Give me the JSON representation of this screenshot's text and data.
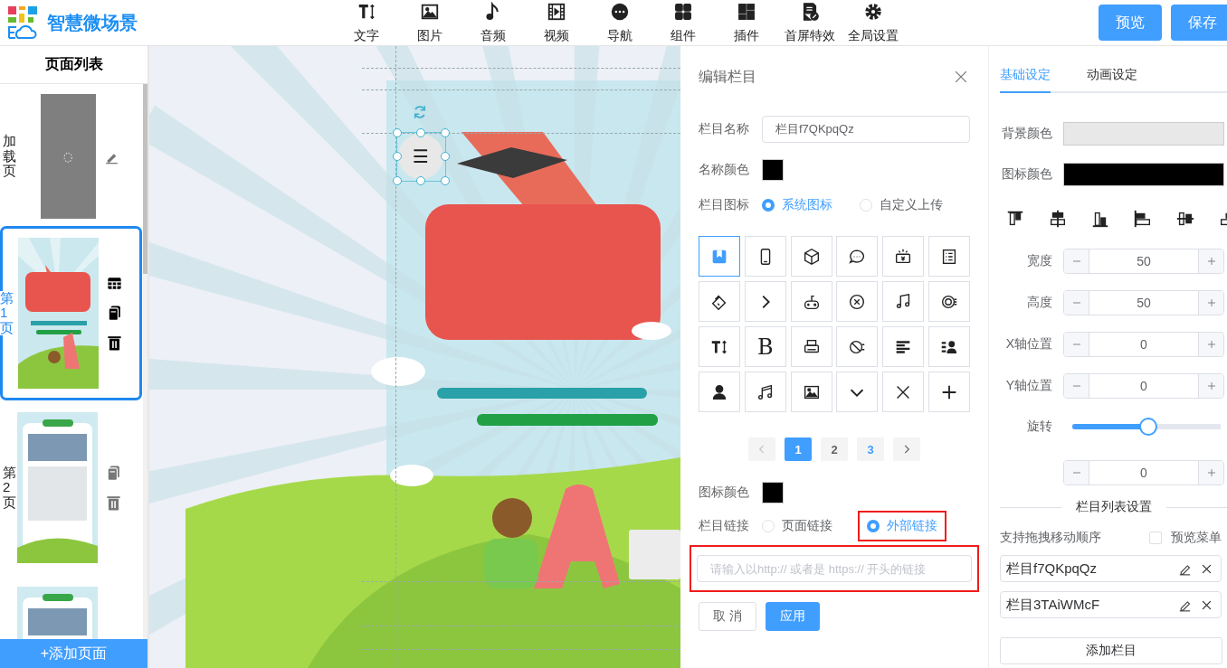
{
  "header": {
    "app_name": "智慧微场景",
    "tools": [
      {
        "label": "文字"
      },
      {
        "label": "图片"
      },
      {
        "label": "音频"
      },
      {
        "label": "视频"
      },
      {
        "label": "导航"
      },
      {
        "label": "组件"
      },
      {
        "label": "插件"
      },
      {
        "label": "首屏特效"
      },
      {
        "label": "全局设置"
      }
    ],
    "buttons": [
      {
        "label": "预览"
      },
      {
        "label": "保存"
      }
    ]
  },
  "page_list": {
    "title": "页面列表",
    "pages": [
      {
        "label": "加载页",
        "selected": false,
        "actions": [
          {
            "kind": "edit"
          }
        ]
      },
      {
        "label": "第1页",
        "selected": true,
        "actions": [
          {
            "kind": "table"
          },
          {
            "kind": "copy"
          },
          {
            "kind": "delete"
          }
        ]
      },
      {
        "label": "第2页",
        "selected": false,
        "actions": [
          {
            "kind": "copy"
          },
          {
            "kind": "delete"
          }
        ]
      },
      {
        "selected": false
      }
    ],
    "add_button": "+添加页面"
  },
  "canvas": {
    "menu_button": "☰"
  },
  "edit_panel": {
    "title": "编辑栏目",
    "name_label": "栏目名称",
    "name_value": "栏目f7QKpqQz",
    "name_color_label": "名称颜色",
    "icon_label": "栏目图标",
    "icon_sources": [
      {
        "label": "系统图标",
        "selected": true
      },
      {
        "label": "自定义上传",
        "selected": false
      }
    ],
    "icons": [
      {
        "selected": true
      },
      {
        "selected": false
      },
      {
        "selected": false
      },
      {
        "selected": false
      },
      {
        "selected": false
      },
      {
        "selected": false
      },
      {
        "selected": false
      },
      {
        "selected": false
      },
      {
        "selected": false
      },
      {
        "selected": false
      },
      {
        "selected": false
      },
      {
        "selected": false
      },
      {
        "selected": false
      },
      {
        "selected": false,
        "glyph": "B"
      },
      {
        "selected": false
      },
      {
        "selected": false
      },
      {
        "selected": false
      },
      {
        "selected": false
      },
      {
        "selected": false
      },
      {
        "selected": false
      },
      {
        "selected": false
      },
      {
        "selected": false
      },
      {
        "selected": false
      },
      {
        "selected": false
      }
    ],
    "pager": {
      "prev": {
        "disabled": true
      },
      "next": {
        "disabled": false
      },
      "pages": [
        {
          "label": "1",
          "selected": true,
          "highlighted": false
        },
        {
          "label": "2",
          "selected": false,
          "highlighted": false
        },
        {
          "label": "3",
          "selected": false,
          "highlighted": true
        }
      ]
    },
    "icon_color_label": "图标颜色",
    "link_label": "栏目链接",
    "link_types": [
      {
        "label": "页面链接",
        "selected": false,
        "highlighted": false
      },
      {
        "label": "外部链接",
        "selected": true,
        "highlighted": true
      }
    ],
    "link_placeholder": "请输入以http:// 或者是 https:// 开头的链接",
    "link_highlighted": true,
    "buttons": [
      {
        "label": "取 消",
        "kind": "plain"
      },
      {
        "label": "应用",
        "kind": "primary"
      }
    ]
  },
  "props_panel": {
    "tabs": [
      {
        "label": "基础设定",
        "selected": true
      },
      {
        "label": "动画设定",
        "selected": false
      }
    ],
    "bg_color_label": "背景颜色",
    "icon_color_label": "图标颜色",
    "steppers": [
      {
        "label": "宽度",
        "value": "50"
      },
      {
        "label": "高度",
        "value": "50"
      },
      {
        "label": "X轴位置",
        "value": "0"
      },
      {
        "label": "Y轴位置",
        "value": "0"
      }
    ],
    "rotation": {
      "label": "旋转",
      "level": 0.51,
      "value": "0"
    },
    "list_title": "栏目列表设置",
    "drag_hint": "支持拖拽移动顺序",
    "preview_menu": {
      "label": "预览菜单",
      "checked": false
    },
    "items": [
      {
        "name": "栏目f7QKpqQz"
      },
      {
        "name": "栏目3TAiWMcF"
      }
    ],
    "add_button": "添加栏目"
  }
}
